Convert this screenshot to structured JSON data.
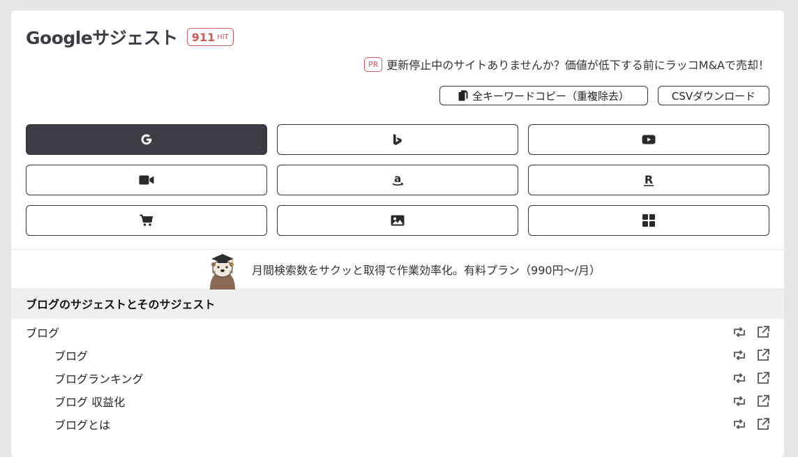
{
  "header": {
    "title": "Googleサジェスト",
    "hit_count": "911",
    "hit_unit": "HIT"
  },
  "pr": {
    "badge": "PR",
    "text": "更新停止中のサイトありませんか？価値が低下する前にラッコM&Aで売却！"
  },
  "actions": {
    "copy_label": "全キーワードコピー（重複除去）",
    "csv_label": "CSVダウンロード"
  },
  "engines": [
    {
      "icon": "google-icon",
      "active": true
    },
    {
      "icon": "bing-icon",
      "active": false
    },
    {
      "icon": "youtube-icon",
      "active": false
    },
    {
      "icon": "video-camera-icon",
      "active": false
    },
    {
      "icon": "amazon-icon",
      "active": false
    },
    {
      "icon": "rakuten-icon",
      "active": false
    },
    {
      "icon": "shopping-cart-icon",
      "active": false
    },
    {
      "icon": "image-icon",
      "active": false
    },
    {
      "icon": "grid-icon",
      "active": false
    }
  ],
  "promo": {
    "text": "月間検索数をサクッと取得で作業効率化。有料プラン（990円〜/月）"
  },
  "section": {
    "title": "ブログのサジェストとそのサジェスト"
  },
  "keywords": [
    {
      "text": "ブログ",
      "level": 0
    },
    {
      "text": "ブログ",
      "level": 1
    },
    {
      "text": "ブログランキング",
      "level": 1
    },
    {
      "text": "ブログ 収益化",
      "level": 1
    },
    {
      "text": "ブログとは",
      "level": 1
    }
  ],
  "colors": {
    "accent_red": "#d0595e",
    "active_button": "#3c3c44",
    "section_bg": "#efefef",
    "page_bg": "#e6e6e6"
  }
}
